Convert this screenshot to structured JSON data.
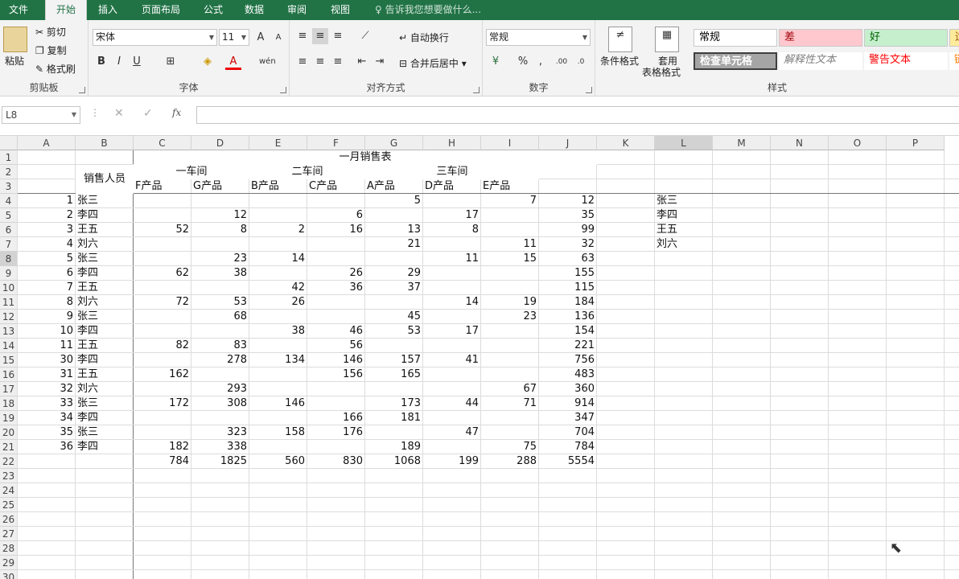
{
  "tabs": [
    "文件",
    "开始",
    "插入",
    "页面布局",
    "公式",
    "数据",
    "审阅",
    "视图"
  ],
  "active_tab": "开始",
  "tell_me": "告诉我您想要做什么...",
  "clipboard": {
    "paste": "粘贴",
    "cut": "剪切",
    "copy": "复制",
    "format_painter": "格式刷",
    "label": "剪贴板"
  },
  "font": {
    "name": "宋体",
    "size": "11",
    "bold": "B",
    "italic": "I",
    "underline": "U",
    "label": "字体"
  },
  "alignment": {
    "wrap": "自动换行",
    "merge": "合并后居中",
    "label": "对齐方式"
  },
  "number": {
    "format": "常规",
    "percent": "%",
    "comma": ",",
    "label": "数字"
  },
  "styles_group": {
    "conditional": "条件格式",
    "table_format_1": "套用",
    "table_format_2": "表格格式",
    "label": "样式",
    "cells": [
      {
        "text": "常规",
        "bg": "#ffffff",
        "color": "#000000"
      },
      {
        "text": "差",
        "bg": "#ffc7ce",
        "color": "#9c0006"
      },
      {
        "text": "好",
        "bg": "#c6efce",
        "color": "#006100"
      },
      {
        "text": "适",
        "bg": "#ffeb9c",
        "color": "#9c5700"
      },
      {
        "text": "检查单元格",
        "bg": "#a5a5a5",
        "color": "#ffffff"
      },
      {
        "text": "解释性文本",
        "bg": "#ffffff",
        "color": "#7f7f7f"
      },
      {
        "text": "警告文本",
        "bg": "#ffffff",
        "color": "#ff0000"
      },
      {
        "text": "链",
        "bg": "#ffffff",
        "color": "#fa7d00"
      }
    ]
  },
  "name_box": "L8",
  "formula": "",
  "columns": [
    "A",
    "B",
    "C",
    "D",
    "E",
    "F",
    "G",
    "H",
    "I",
    "J",
    "K",
    "L",
    "M",
    "N",
    "O",
    "P"
  ],
  "rows": [
    "1",
    "2",
    "3",
    "4",
    "5",
    "6",
    "7",
    "8",
    "9",
    "10",
    "11",
    "12",
    "13",
    "14",
    "15",
    "16",
    "17",
    "18",
    "19",
    "20",
    "21",
    "22",
    "23",
    "24",
    "25",
    "26",
    "27",
    "28",
    "29",
    "30"
  ],
  "sheet": {
    "title": "一月销售表",
    "salesperson_header": "销售人员",
    "workshops": [
      "一车间",
      "二车间",
      "三车间"
    ],
    "products": [
      "F产品",
      "G产品",
      "B产品",
      "C产品",
      "A产品",
      "D产品",
      "E产品"
    ],
    "data": [
      [
        "1",
        "张三",
        "",
        "",
        "",
        "",
        "5",
        "",
        "7",
        "12"
      ],
      [
        "2",
        "李四",
        "",
        "12",
        "",
        "6",
        "",
        "17",
        "",
        "35"
      ],
      [
        "3",
        "王五",
        "52",
        "8",
        "2",
        "16",
        "13",
        "8",
        "",
        "99"
      ],
      [
        "4",
        "刘六",
        "",
        "",
        "",
        "",
        "21",
        "",
        "11",
        "32"
      ],
      [
        "5",
        "张三",
        "",
        "23",
        "14",
        "",
        "",
        "11",
        "15",
        "63"
      ],
      [
        "6",
        "李四",
        "62",
        "38",
        "",
        "26",
        "29",
        "",
        "",
        "155"
      ],
      [
        "7",
        "王五",
        "",
        "",
        "42",
        "36",
        "37",
        "",
        "",
        "115"
      ],
      [
        "8",
        "刘六",
        "72",
        "53",
        "26",
        "",
        "",
        "14",
        "19",
        "184"
      ],
      [
        "9",
        "张三",
        "",
        "68",
        "",
        "",
        "45",
        "",
        "23",
        "136"
      ],
      [
        "10",
        "李四",
        "",
        "",
        "38",
        "46",
        "53",
        "17",
        "",
        "154"
      ],
      [
        "11",
        "王五",
        "82",
        "83",
        "",
        "56",
        "",
        "",
        "",
        "221"
      ],
      [
        "30",
        "李四",
        "",
        "278",
        "134",
        "146",
        "157",
        "41",
        "",
        "756"
      ],
      [
        "31",
        "王五",
        "162",
        "",
        "",
        "156",
        "165",
        "",
        "",
        "483"
      ],
      [
        "32",
        "刘六",
        "",
        "293",
        "",
        "",
        "",
        "",
        "67",
        "360"
      ],
      [
        "33",
        "张三",
        "172",
        "308",
        "146",
        "",
        "173",
        "44",
        "71",
        "914"
      ],
      [
        "34",
        "李四",
        "",
        "",
        "",
        "166",
        "181",
        "",
        "",
        "347"
      ],
      [
        "35",
        "张三",
        "",
        "323",
        "158",
        "176",
        "",
        "47",
        "",
        "704"
      ],
      [
        "36",
        "李四",
        "182",
        "338",
        "",
        "",
        "189",
        "",
        "75",
        "784"
      ]
    ],
    "totals": [
      "",
      "",
      "784",
      "1825",
      "560",
      "830",
      "1068",
      "199",
      "288",
      "5554"
    ],
    "names_list": [
      "张三",
      "李四",
      "王五",
      "刘六"
    ]
  }
}
